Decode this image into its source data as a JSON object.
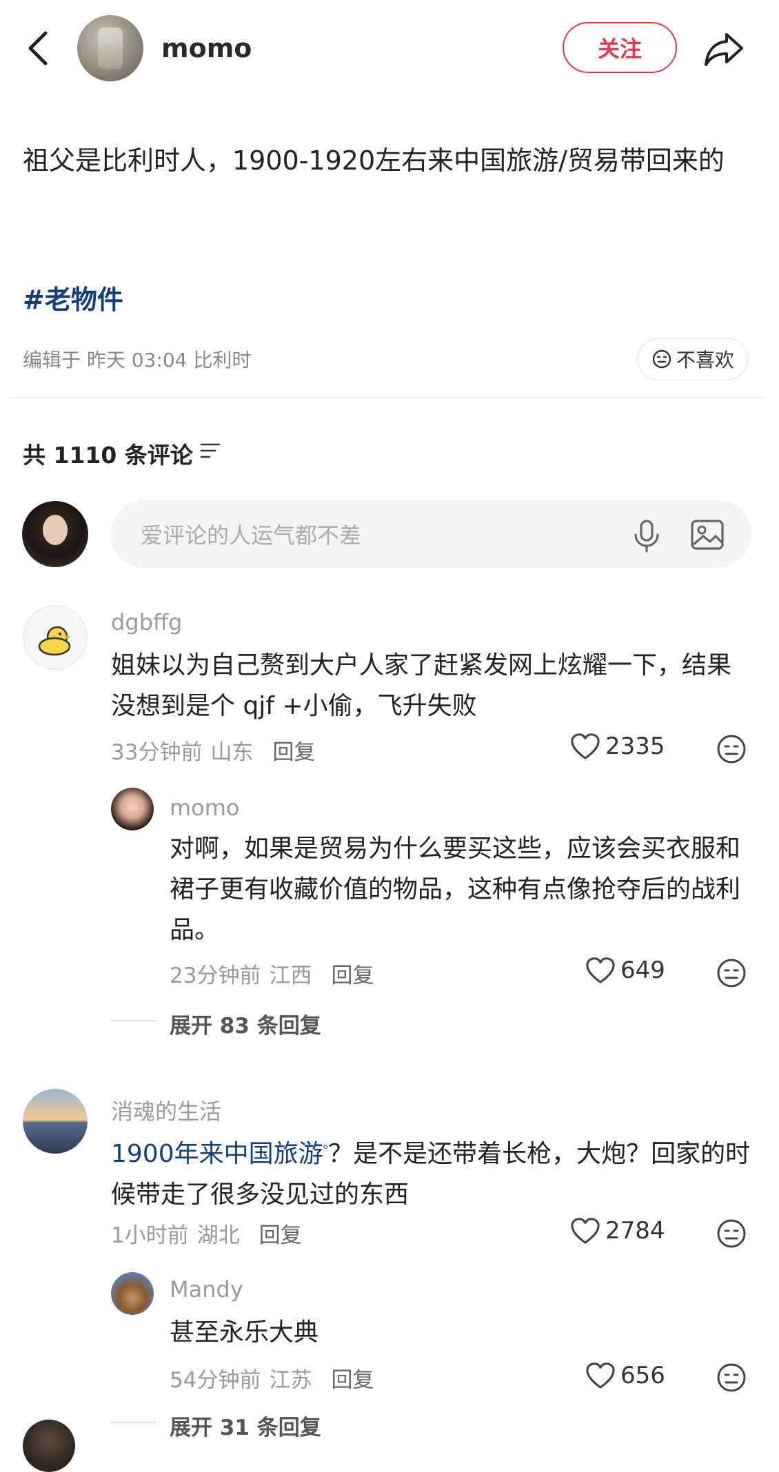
{
  "header": {
    "author_name": "momo",
    "follow_label": "关注",
    "back_icon": "chevron-left-icon",
    "share_icon": "share-arrow-icon"
  },
  "post": {
    "text": "祖父是比利时人，1900-1920左右来中国旅游/贸易带回来的",
    "tag": "#老物件",
    "meta": "编辑于 昨天 03:04 比利时",
    "dislike_label": "不喜欢"
  },
  "comments_header": {
    "count_label": "共 1110 条评论"
  },
  "comment_input": {
    "placeholder": "爱评论的人运气都不差"
  },
  "comments": [
    {
      "user": "dgbffg",
      "text": "姐妹以为自己赘到大户人家了赶紧发网上炫耀一下，结果没想到是个 qjf +小偷，飞升失败",
      "time": "33分钟前",
      "location": "山东",
      "reply_label": "回复",
      "likes": "2335",
      "replies": [
        {
          "user": "momo",
          "text": "对啊，如果是贸易为什么要买这些，应该会买衣服和裙子更有收藏价值的物品，这种有点像抢夺后的战利品。",
          "time": "23分钟前",
          "location": "江西",
          "reply_label": "回复",
          "likes": "649"
        }
      ],
      "expand_label": "展开 83 条回复"
    },
    {
      "user": "消魂的生活",
      "text_highlight": "1900年来中国旅游",
      "text_rest": "？是不是还带着长枪，大炮？回家的时候带走了很多没见过的东西",
      "time": "1小时前",
      "location": "湖北",
      "reply_label": "回复",
      "likes": "2784",
      "replies": [
        {
          "user": "Mandy",
          "text": "甚至永乐大典",
          "time": "54分钟前",
          "location": "江苏",
          "reply_label": "回复",
          "likes": "656"
        }
      ],
      "expand_label": "展开 31 条回复"
    }
  ],
  "colors": {
    "accent": "#e8364f",
    "link": "#133f7f",
    "muted": "#999999"
  }
}
